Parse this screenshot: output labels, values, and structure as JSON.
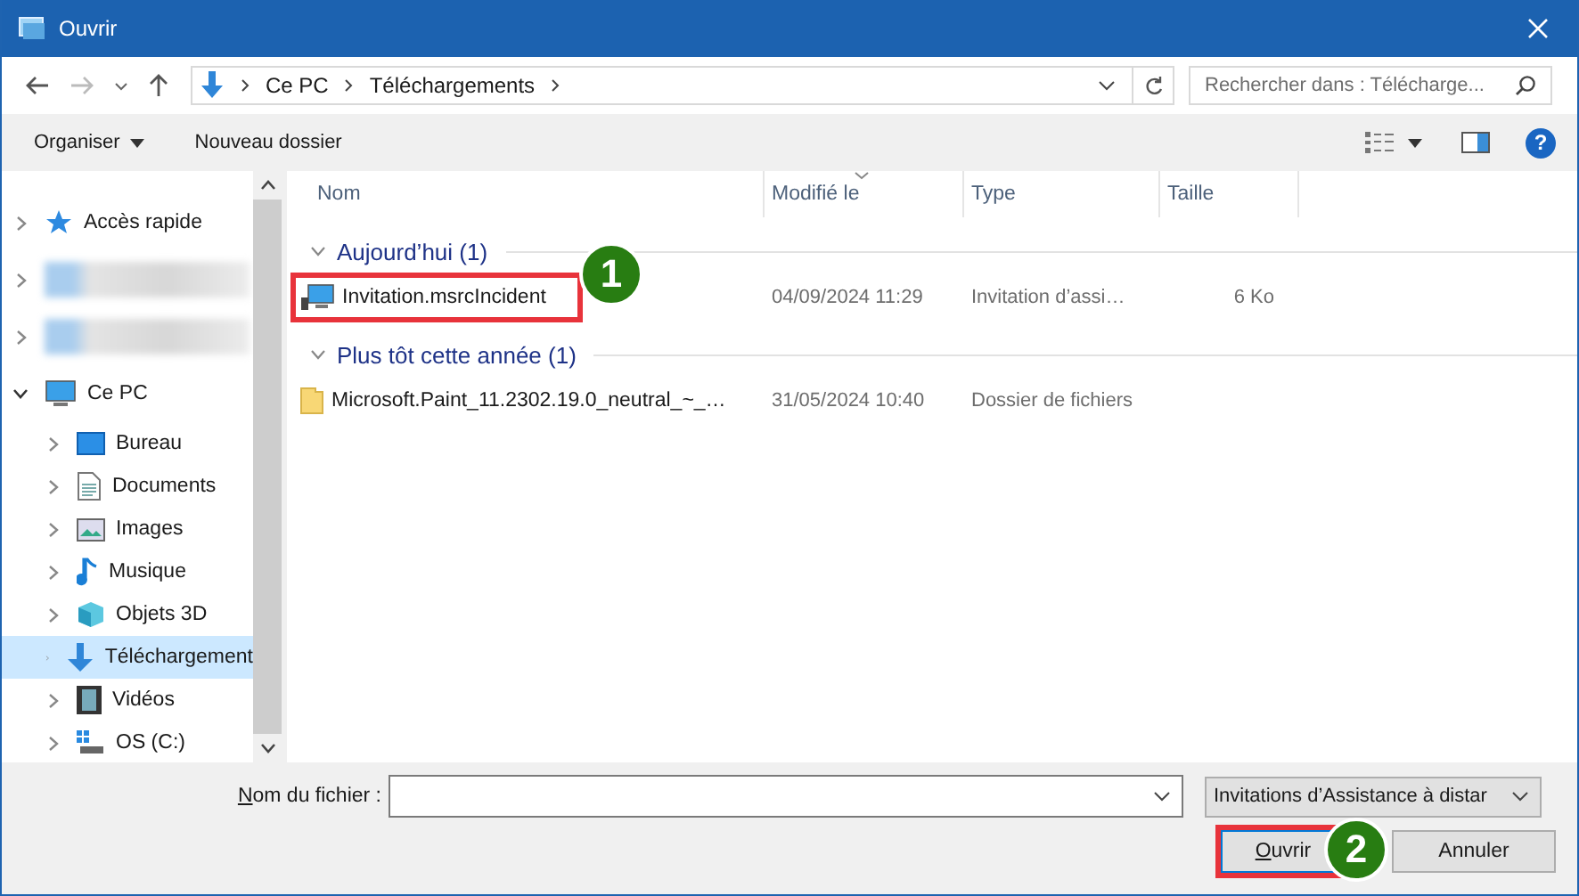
{
  "window": {
    "title": "Ouvrir"
  },
  "address": {
    "segments": [
      "Ce PC",
      "Téléchargements"
    ]
  },
  "search": {
    "placeholder": "Rechercher dans : Télécharge..."
  },
  "toolbar": {
    "organize": "Organiser",
    "new_folder": "Nouveau dossier",
    "help": "?"
  },
  "sidebar": {
    "items": [
      {
        "kind": "quick-access",
        "label": "Accès rapide",
        "expanded": false,
        "selected": false
      },
      {
        "kind": "blurred",
        "expanded": false,
        "selected": false
      },
      {
        "kind": "blurred",
        "expanded": false,
        "selected": false
      },
      {
        "kind": "pc",
        "label": "Ce PC",
        "expanded": true,
        "selected": false,
        "children": [
          {
            "kind": "desktop",
            "label": "Bureau",
            "expanded": false,
            "selected": false
          },
          {
            "kind": "documents",
            "label": "Documents",
            "expanded": false,
            "selected": false
          },
          {
            "kind": "images",
            "label": "Images",
            "expanded": false,
            "selected": false
          },
          {
            "kind": "music",
            "label": "Musique",
            "expanded": false,
            "selected": false
          },
          {
            "kind": "objects3d",
            "label": "Objets 3D",
            "expanded": false,
            "selected": false
          },
          {
            "kind": "downloads",
            "label": "Téléchargement",
            "expanded": false,
            "selected": true
          },
          {
            "kind": "videos",
            "label": "Vidéos",
            "expanded": false,
            "selected": false
          },
          {
            "kind": "drive",
            "label": "OS (C:)",
            "expanded": false,
            "selected": false
          }
        ]
      }
    ]
  },
  "columns": [
    {
      "label": "Nom",
      "sorted": false
    },
    {
      "label": "Modifié le",
      "sorted": true
    },
    {
      "label": "Type",
      "sorted": false
    },
    {
      "label": "Taille",
      "sorted": false
    }
  ],
  "groups": [
    {
      "label": "Aujourd’hui (1)",
      "expanded": true,
      "files": [
        {
          "kind": "remote",
          "name": "Invitation.msrcIncident",
          "modified": "04/09/2024 11:29",
          "type": "Invitation d’assi…",
          "size": "6 Ko",
          "highlighted": true,
          "badge": "1"
        }
      ]
    },
    {
      "label": "Plus tôt cette année (1)",
      "expanded": true,
      "files": [
        {
          "kind": "folder",
          "name": "Microsoft.Paint_11.2302.19.0_neutral_~_…",
          "modified": "31/05/2024 10:40",
          "type": "Dossier de fichiers",
          "highlighted": false
        }
      ]
    }
  ],
  "file_name": {
    "label": "Nom du fichier :"
  },
  "filter": {
    "value": "Invitations d’Assistance à distar"
  },
  "buttons": [
    {
      "label": "Ouvrir",
      "default": true,
      "highlighted": true,
      "badge": "2"
    },
    {
      "label": "Annuler",
      "default": false,
      "highlighted": false
    }
  ]
}
